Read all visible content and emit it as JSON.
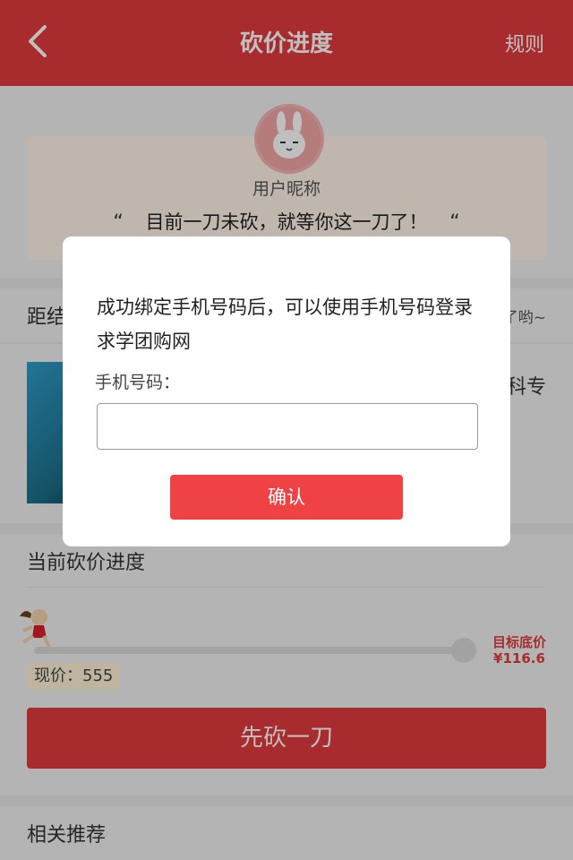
{
  "header": {
    "title": "砍价进度",
    "rule_label": "规则",
    "back_icon": "chevron-left-icon"
  },
  "user": {
    "nickname": "用户昵称",
    "quote_text": "目前一刀未砍，就等你这一刀了！",
    "quote_mark": "“"
  },
  "countdown": {
    "left_text": "距结",
    "right_text": "了哟~"
  },
  "product": {
    "name_partial": "科专"
  },
  "progress": {
    "title": "当前砍价进度",
    "current_price_label": "现价：555",
    "target_label": "目标底价",
    "target_price": "¥116.6"
  },
  "actions": {
    "cut_label": "先砍一刀"
  },
  "recommend": {
    "title": "相关推荐"
  },
  "modal": {
    "message": "成功绑定手机号码后，可以使用手机号码登录求学团购网",
    "phone_label": "手机号码：",
    "phone_value": "",
    "phone_placeholder": "",
    "confirm_label": "确认"
  },
  "colors": {
    "primary": "#e03a3e",
    "modal_button": "#ee4245",
    "panel_bg": "#fff5e8",
    "price_bg": "#fff1d6"
  }
}
